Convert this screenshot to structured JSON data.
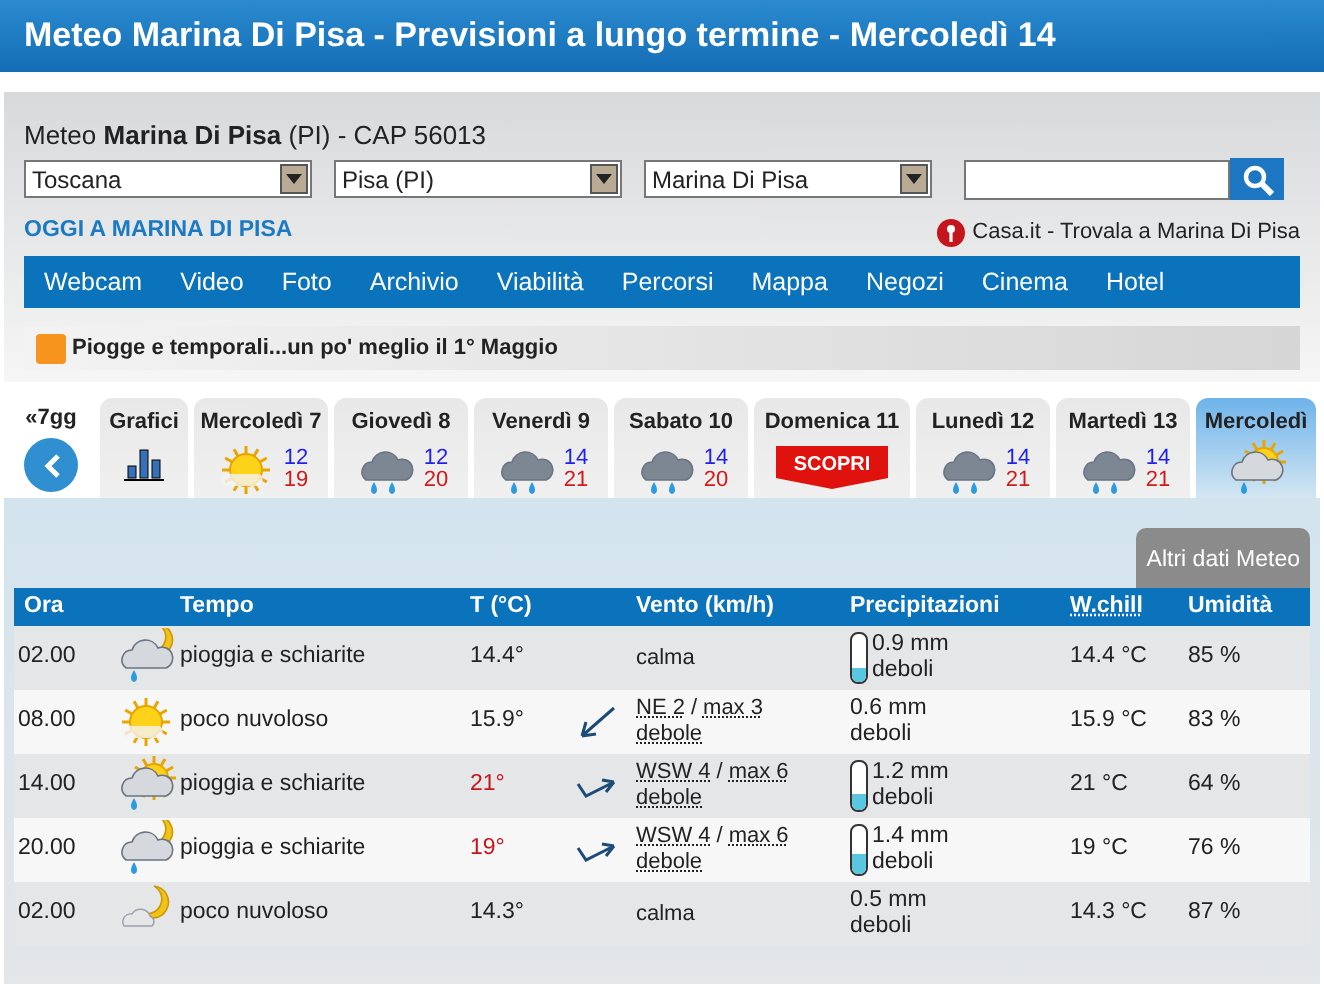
{
  "title": "Meteo Marina Di Pisa - Previsioni a lungo termine - Mercoledì 14",
  "location": {
    "prefix": "Meteo",
    "name": "Marina Di Pisa",
    "suffix": "(PI) - CAP 56013"
  },
  "selects": [
    "Toscana",
    "Pisa (PI)",
    "Marina Di Pisa"
  ],
  "today_link": "OGGI A MARINA DI PISA",
  "casa_link": "Casa.it - Trovala a Marina Di Pisa",
  "nav": [
    "Webcam",
    "Video",
    "Foto",
    "Archivio",
    "Viabilità",
    "Percorsi",
    "Mappa",
    "Negozi",
    "Cinema",
    "Hotel"
  ],
  "news": "Piogge e temporali...un po' meglio il 1° Maggio",
  "back": "«7gg",
  "days": [
    {
      "kind": "chart",
      "label": "Grafici",
      "selected": false
    },
    {
      "kind": "sun",
      "label": "Mercoledì 7",
      "min": "12",
      "max": "19",
      "selected": false
    },
    {
      "kind": "rain",
      "label": "Giovedì 8",
      "min": "12",
      "max": "20",
      "selected": false
    },
    {
      "kind": "rain",
      "label": "Venerdì 9",
      "min": "14",
      "max": "21",
      "selected": false
    },
    {
      "kind": "rain",
      "label": "Sabato 10",
      "min": "14",
      "max": "20",
      "selected": false
    },
    {
      "kind": "promo",
      "label": "Domenica 11",
      "badge": "SCOPRI",
      "selected": false
    },
    {
      "kind": "rain",
      "label": "Lunedì 12",
      "min": "14",
      "max": "21",
      "selected": false
    },
    {
      "kind": "rain",
      "label": "Martedì 13",
      "min": "14",
      "max": "21",
      "selected": false
    },
    {
      "kind": "sun_rain",
      "label": "Mercoledì",
      "selected": true
    }
  ],
  "more_tab": "Altri dati Meteo",
  "columns": [
    "Ora",
    "Tempo",
    "T (°C)",
    "Vento (km/h)",
    "Precipitazioni",
    "W.chill",
    "Umidità"
  ],
  "rows": [
    {
      "kind": "moon_rain",
      "time": "02.00",
      "desc": "pioggia e schiarite",
      "temp": "14.4°",
      "warm": false,
      "wind": {
        "speed": "calma"
      },
      "rain": {
        "amount": "0.9 mm",
        "label": "deboli",
        "level": 0.3
      },
      "chill": "14.4 °C",
      "humidity": "85 %"
    },
    {
      "kind": "sun",
      "time": "08.00",
      "desc": "poco nuvoloso",
      "temp": "15.9°",
      "warm": false,
      "wind": {
        "kind": "sw",
        "speed": "NE 2",
        "separator": "/",
        "max": "max 3",
        "strength": "debole"
      },
      "rain": {
        "amount": "0.6 mm",
        "label": "deboli"
      },
      "chill": "15.9 °C",
      "humidity": "83 %"
    },
    {
      "kind": "sun_rain",
      "time": "14.00",
      "desc": "pioggia e schiarite",
      "temp": "21°",
      "warm": true,
      "wind": {
        "kind": "ene",
        "speed": "WSW 4",
        "separator": "/",
        "max": "max 6",
        "strength": "debole"
      },
      "rain": {
        "amount": "1.2 mm",
        "label": "deboli",
        "level": 0.35
      },
      "chill": "21 °C",
      "humidity": "64 %"
    },
    {
      "kind": "moon_rain",
      "time": "20.00",
      "desc": "pioggia e schiarite",
      "temp": "19°",
      "warm": true,
      "wind": {
        "kind": "ene",
        "speed": "WSW 4",
        "separator": "/",
        "max": "max 6",
        "strength": "debole"
      },
      "rain": {
        "amount": "1.4 mm",
        "label": "deboli",
        "level": 0.4
      },
      "chill": "19 °C",
      "humidity": "76 %"
    },
    {
      "kind": "moon_cloud",
      "time": "02.00",
      "desc": "poco nuvoloso",
      "temp": "14.3°",
      "warm": false,
      "wind": {
        "speed": "calma"
      },
      "rain": {
        "amount": "0.5 mm",
        "label": "deboli"
      },
      "chill": "14.3 °C",
      "humidity": "87 %"
    }
  ]
}
